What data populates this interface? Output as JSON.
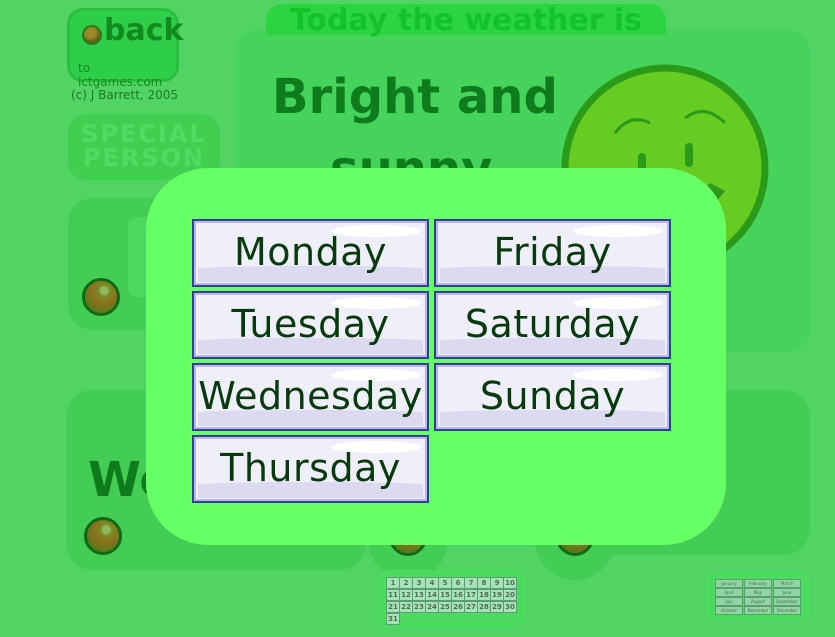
{
  "back_button": {
    "word": "back",
    "site": "to ictgames.com"
  },
  "copyright": "(c) J Barrett, 2005",
  "special_person": {
    "line1": "SPECIAL",
    "line2": "PERSON"
  },
  "weather": {
    "title": "Today the weather is",
    "line1": "Bright and",
    "line2": "sunny"
  },
  "date_fragment": "We",
  "day_picker": {
    "days": [
      "Monday",
      "Tuesday",
      "Wednesday",
      "Thursday",
      "Friday",
      "Saturday",
      "Sunday"
    ]
  },
  "calendar_dates": [
    "1",
    "2",
    "3",
    "4",
    "5",
    "6",
    "7",
    "8",
    "9",
    "10",
    "11",
    "12",
    "13",
    "14",
    "15",
    "16",
    "17",
    "18",
    "19",
    "20",
    "21",
    "22",
    "23",
    "24",
    "25",
    "26",
    "27",
    "28",
    "29",
    "30",
    "31"
  ],
  "months": [
    "January",
    "February",
    "March",
    "April",
    "May",
    "June",
    "July",
    "August",
    "September",
    "October",
    "November",
    "December"
  ],
  "colors": {
    "background": "#52d464",
    "overlay": "#66ff66",
    "button_face": "#efeff9",
    "button_border": "#3a3a9a",
    "day_text": "#073a0d",
    "heading_text": "#0e7c1c"
  }
}
